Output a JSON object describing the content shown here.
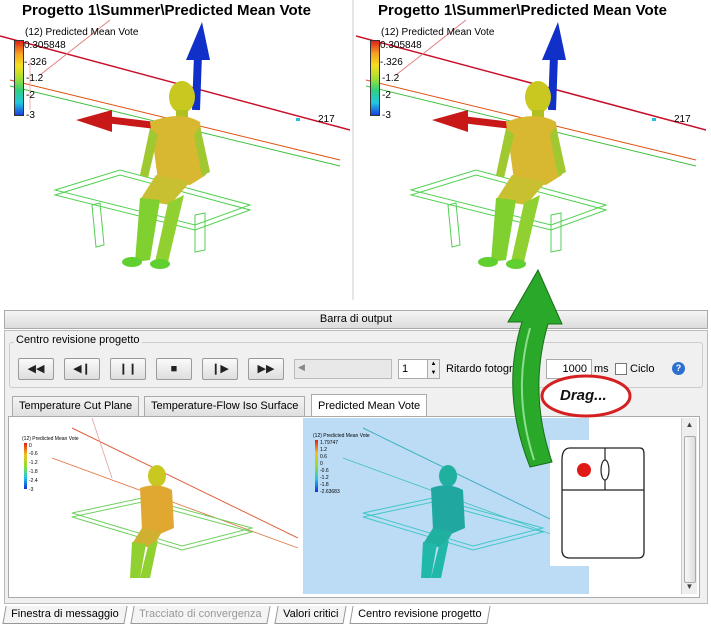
{
  "views": [
    {
      "title": "Progetto 1\\Summer\\Predicted Mean Vote",
      "legend_name": "(12) Predicted Mean Vote",
      "legend_ticks": [
        "0.305848",
        "-.326",
        "-1.2",
        "-2",
        "-3"
      ],
      "axis_label": "217"
    },
    {
      "title": "Progetto 1\\Summer\\Predicted Mean Vote",
      "legend_name": "(12) Predicted Mean Vote",
      "legend_ticks": [
        "0.305848",
        "-.326",
        "-1.2",
        "-2",
        "-3"
      ],
      "axis_label": "217"
    }
  ],
  "output_bar": {
    "label": "Barra di output"
  },
  "review_center": {
    "group_label": "Centro revisione progetto",
    "controls": [
      {
        "icon": "rewind-icon",
        "glyph": "◀◀"
      },
      {
        "icon": "step-back-icon",
        "glyph": "◀❙"
      },
      {
        "icon": "pause-icon",
        "glyph": "❙❙"
      },
      {
        "icon": "stop-icon",
        "glyph": "■"
      },
      {
        "icon": "step-forward-icon",
        "glyph": "❙▶"
      },
      {
        "icon": "fast-forward-icon",
        "glyph": "▶▶"
      }
    ],
    "frame_value": "1",
    "delay_label": "Ritardo fotogram",
    "delay_value": "1000",
    "delay_unit": "ms",
    "loop_label": "Ciclo",
    "loop_checked": false,
    "help_glyph": "?"
  },
  "tabs": [
    {
      "label": "Temperature Cut Plane",
      "active": false
    },
    {
      "label": "Temperature-Flow Iso Surface",
      "active": false
    },
    {
      "label": "Predicted Mean Vote",
      "active": true
    }
  ],
  "thumbnails": [
    {
      "legend_name": "(12) Predicted Mean Vote",
      "ticks": [
        "0",
        "-0.6",
        "-1.2",
        "-1.8",
        "-2.4",
        "-3"
      ],
      "selected": false
    },
    {
      "legend_name": "(12) Predicted Mean Vote",
      "ticks": [
        "1.79747",
        "1.2",
        "0.6",
        "0",
        "-0.6",
        "-1.2",
        "-1.8",
        "-2.63683"
      ],
      "selected": true
    }
  ],
  "drag_hint": {
    "label": "Drag..."
  },
  "bottom_tabs": [
    {
      "label": "Finestra di messaggio",
      "disabled": false,
      "active": false
    },
    {
      "label": "Tracciato di convergenza",
      "disabled": true,
      "active": false
    },
    {
      "label": "Valori critici",
      "disabled": false,
      "active": false
    },
    {
      "label": "Centro revisione progetto",
      "disabled": false,
      "active": true
    }
  ],
  "colors": {
    "accent_green": "#2aa82a",
    "drag_bubble_border": "#d42020",
    "selected_thumb_bg": "#bcdcf6",
    "axis_blue": "#1030c8",
    "axis_red": "#c81818"
  }
}
